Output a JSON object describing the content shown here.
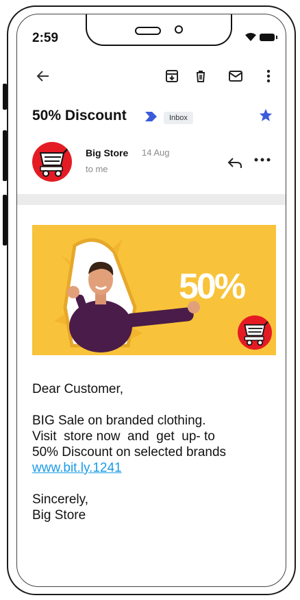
{
  "status": {
    "time": "2:59"
  },
  "email": {
    "subject": "50% Discount",
    "label_chip": "Inbox",
    "sender": {
      "name": "Big Store",
      "date": "14 Aug",
      "recipient": "to me"
    },
    "banner": {
      "promo_text": "50%"
    },
    "body": {
      "greeting": "Dear Customer,",
      "line1": "BIG Sale on branded clothing.",
      "line2": "Visit  store now  and  get  up- to",
      "line3": "50% Discount on selected brands",
      "link": "www.bit.ly.1241",
      "signoff": "Sincerely,",
      "signature": "Big Store"
    }
  },
  "icons": {
    "back": "arrow-left-icon",
    "archive": "archive-icon",
    "delete": "trash-icon",
    "mark_unread": "mail-icon",
    "overflow": "more-vert-icon",
    "importance": "importance-marker-icon",
    "star": "star-icon",
    "reply": "reply-icon",
    "more": "more-horiz-icon"
  },
  "colors": {
    "accent": "#3b5bdb",
    "link": "#1a9be6",
    "brand_red": "#e51b24",
    "banner_yellow": "#f8c33a"
  }
}
